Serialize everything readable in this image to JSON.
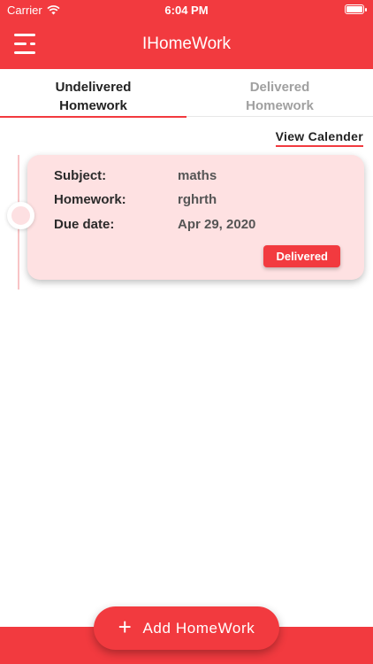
{
  "status_bar": {
    "carrier": "Carrier",
    "time": "6:04 PM"
  },
  "app_bar": {
    "title": "IHomeWork",
    "menu_icon": "menu-icon"
  },
  "tabs": [
    {
      "line1": "Undelivered",
      "line2": "Homework",
      "active": true
    },
    {
      "line1": "Delivered",
      "line2": "Homework",
      "active": false
    }
  ],
  "view_calendar_label": "View Calender",
  "homework_card": {
    "subject_label": "Subject:",
    "subject_value": "maths",
    "homework_label": "Homework:",
    "homework_value": "rghrth",
    "due_label": "Due date:",
    "due_value": "Apr 29, 2020",
    "status_button": "Delivered"
  },
  "add_button": {
    "label": "Add HomeWork",
    "icon": "plus-icon"
  },
  "colors": {
    "primary": "#f23a3f",
    "card_bg": "#fee1e2"
  }
}
